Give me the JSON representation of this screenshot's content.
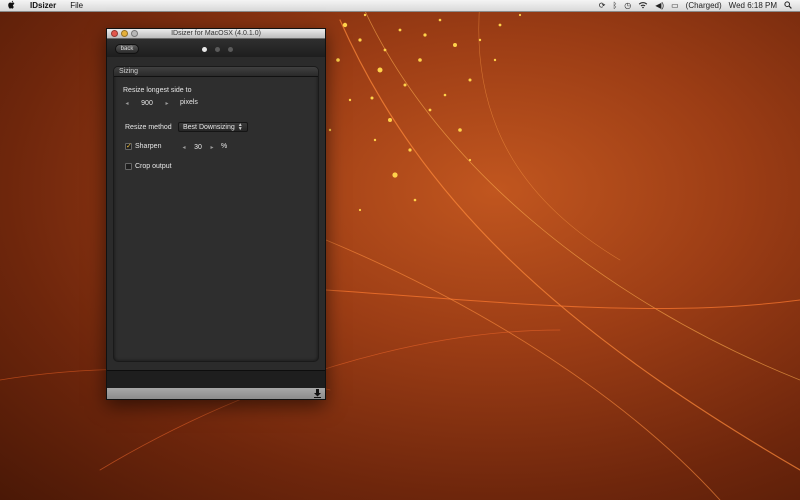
{
  "menubar": {
    "apple_icon": "",
    "app_name": "IDsizer",
    "menu_file": "File",
    "battery_status": "(Charged)",
    "clock": "Wed 6:18 PM"
  },
  "window": {
    "title": "IDsizer for MacOSX (4.0.1.0)",
    "back_label": "back",
    "page_count": 3,
    "active_page": 1
  },
  "sizing": {
    "header": "Sizing",
    "resize_label": "Resize longest side to",
    "resize_value": "900",
    "resize_unit": "pixels",
    "method_label": "Resize method",
    "method_value": "Best Downsizing",
    "sharpen_label": "Sharpen",
    "sharpen_checked": true,
    "sharpen_value": "30",
    "sharpen_unit": "%",
    "crop_label": "Crop output",
    "crop_checked": false
  },
  "icons": {
    "apple": "apple-icon",
    "download": "download-icon",
    "checkmark": "checkmark-icon"
  },
  "colors": {
    "desktop_accent": "#c1561f",
    "spark": "#ffd24a",
    "window_bg": "#2b2b2b"
  }
}
